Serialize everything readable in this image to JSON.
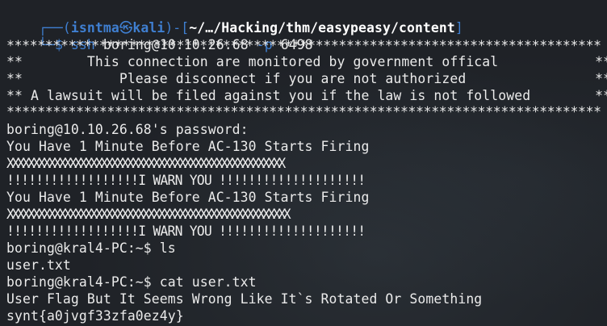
{
  "prompt": {
    "frame_top_left": "┌──(",
    "user": "isntma",
    "skull": "㉿",
    "host": "kali",
    "frame_mid": ")-[",
    "path": "~/…/Hacking/thm/easypeasy/content",
    "frame_close": "]",
    "frame_bottom": "└─",
    "sign": "$",
    "command": "ssh",
    "target": "boring@10.10.26.68",
    "option": "-p",
    "port": "6498"
  },
  "banner": [
    "*****************************************************************************",
    "**        This connection are monitored by government offical            **",
    "**            Please disconnect if you are not authorized                **",
    "** A lawsuit will be filed against you if the law is not followed        **",
    "*****************************************************************************"
  ],
  "output": [
    "boring@10.10.26.68's password:",
    "You Have 1 Minute Before AC-130 Starts Firing",
    "XXXXXXXXXXXXXXXXXXXXXXXXXXXXXXXXXXXXXXXXXXXXXXXXXXXXX",
    "!!!!!!!!!!!!!!!!!!I WARN YOU !!!!!!!!!!!!!!!!!!!!",
    "You Have 1 Minute Before AC-130 Starts Firing",
    "XXXXXXXXXXXXXXXXXXXXXXXXXXXXXXXXXXXXXXXXXXXXXXXXXXXXXX",
    "!!!!!!!!!!!!!!!!!!I WARN YOU !!!!!!!!!!!!!!!!!!!!",
    "boring@kral4-PC:~$ ls",
    "user.txt",
    "boring@kral4-PC:~$ cat user.txt",
    "User Flag But It Seems Wrong Like It`s Rotated Or Something",
    "synt{a0jvgf33zfa0ez4y}"
  ],
  "colors": {
    "background": "#1f2227",
    "prompt_blue": "#3f7fd1",
    "text": "#eaeaea"
  }
}
